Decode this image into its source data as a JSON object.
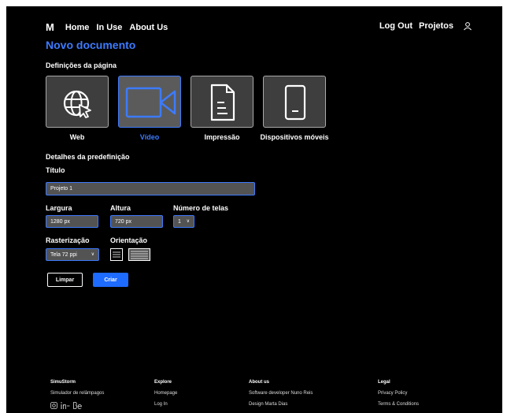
{
  "nav": {
    "logo": "M",
    "links": [
      "Home",
      "In Use",
      "About Us"
    ],
    "right_links": [
      "Log Out",
      "Projetos"
    ],
    "user_icon": "user-icon"
  },
  "page_title": "Novo documento",
  "page_settings": {
    "heading": "Definições da página",
    "cards": [
      {
        "label": "Web",
        "icon": "globe-cursor-icon",
        "selected": false
      },
      {
        "label": "Vídeo",
        "icon": "video-camera-icon",
        "selected": true
      },
      {
        "label": "Impressão",
        "icon": "document-icon",
        "selected": false
      },
      {
        "label": "Dispositivos móveis",
        "icon": "mobile-device-icon",
        "selected": false
      }
    ]
  },
  "preset": {
    "heading": "Detalhes da predefinição",
    "title_label": "Título",
    "title_value": "Projeto 1",
    "width_label": "Largura",
    "width_value": "1280 px",
    "height_label": "Altura",
    "height_value": "720 px",
    "screens_label": "Número de telas",
    "screens_value": "1",
    "raster_label": "Rasterização",
    "raster_value": "Tela 72 ppi",
    "orientation_label": "Orientação",
    "orientation_options": [
      "portrait-icon",
      "landscape-icon"
    ]
  },
  "actions": {
    "clear": "Limpar",
    "create": "Criar"
  },
  "footer": {
    "col1": {
      "heading": "SimuStorm",
      "items": [
        "Simulador de relâmpagos"
      ]
    },
    "col2": {
      "heading": "Explore",
      "items": [
        "Homepage",
        "Log In"
      ]
    },
    "col3": {
      "heading": "About us",
      "items": [
        "Software developer Nuno Reis",
        "Design Marta Dias"
      ]
    },
    "col4": {
      "heading": "Legal",
      "items": [
        "Privacy Policy",
        "Terms & Conditions"
      ]
    },
    "social_icons": [
      "instagram-icon",
      "linkedin-icon",
      "behance-icon"
    ]
  },
  "colors": {
    "accent": "#3d7bff",
    "background": "#000000",
    "card": "#3e3e3e",
    "field": "#535353",
    "primary_button": "#1e6bff"
  }
}
